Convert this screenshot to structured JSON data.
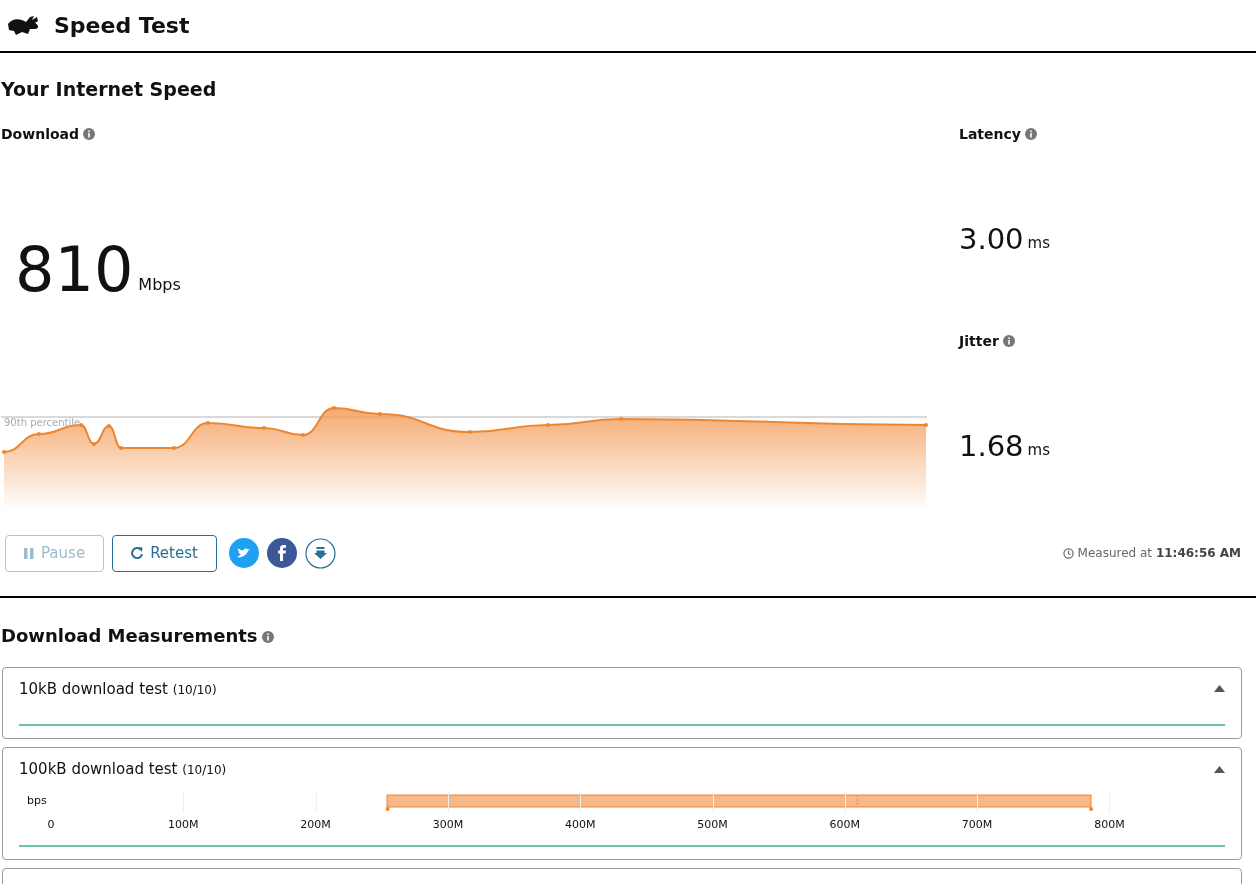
{
  "header": {
    "title": "Speed Test"
  },
  "summary": {
    "heading": "Your Internet Speed",
    "download": {
      "label": "Download",
      "value": "810",
      "unit": "Mbps",
      "percentile_label": "90th percentile"
    },
    "latency": {
      "label": "Latency",
      "value": "3.00",
      "unit": "ms"
    },
    "jitter": {
      "label": "Jitter",
      "value": "1.68",
      "unit": "ms"
    },
    "buttons": [
      {
        "label": "Pause",
        "disabled": true,
        "kind": "pause"
      },
      {
        "label": "Retest",
        "disabled": false,
        "kind": "retest"
      }
    ],
    "share": [
      {
        "kind": "twitter"
      },
      {
        "kind": "facebook"
      },
      {
        "kind": "download"
      }
    ],
    "measured": {
      "prefix": "Measured at",
      "time": "11:46:56 AM"
    }
  },
  "measurements": {
    "heading": "Download Measurements",
    "tests": [
      {
        "title": "10kB download test",
        "count": "(10/10)",
        "expanded": true
      },
      {
        "title": "100kB download test",
        "count": "(10/10)",
        "expanded": true,
        "axis_label": "bps",
        "ticks": [
          "0",
          "100M",
          "200M",
          "300M",
          "400M",
          "500M",
          "600M",
          "700M",
          "800M"
        ]
      }
    ]
  }
}
